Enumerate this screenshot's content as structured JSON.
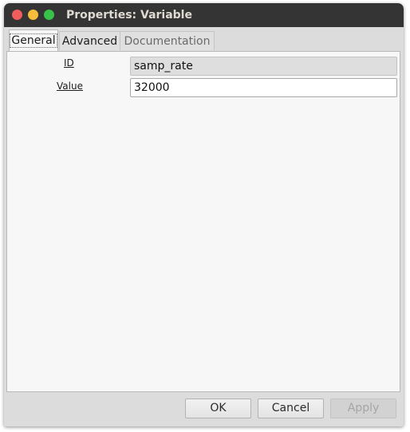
{
  "window": {
    "title": "Properties: Variable"
  },
  "tabs": [
    {
      "label": "General",
      "active": true
    },
    {
      "label": "Advanced",
      "active": false
    },
    {
      "label": "Documentation",
      "active": false
    }
  ],
  "params": {
    "id": {
      "label": "ID",
      "value": "samp_rate"
    },
    "value": {
      "label": "Value",
      "value": "32000"
    }
  },
  "buttons": {
    "ok": "OK",
    "cancel": "Cancel",
    "apply": "Apply"
  }
}
